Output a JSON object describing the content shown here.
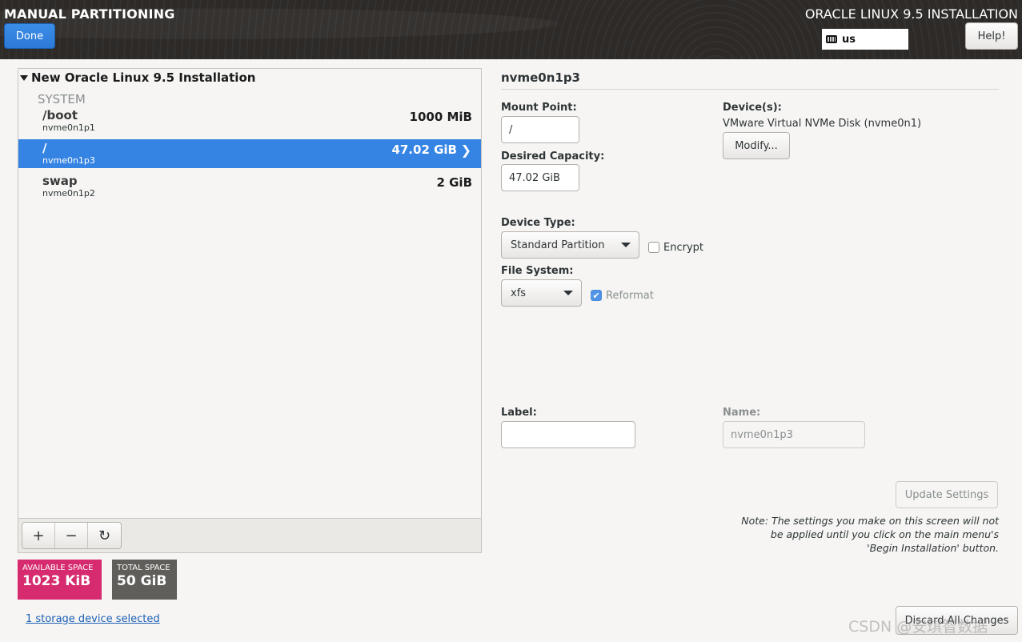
{
  "header": {
    "title": "MANUAL PARTITIONING",
    "product": "ORACLE LINUX 9.5 INSTALLATION",
    "done_label": "Done",
    "keyboard_layout": "us",
    "help_label": "Help!"
  },
  "tree": {
    "installation_title": "New Oracle Linux 9.5 Installation",
    "group_label": "SYSTEM",
    "partitions": [
      {
        "mount": "/boot",
        "device": "nvme0n1p1",
        "size": "1000 MiB",
        "selected": false
      },
      {
        "mount": "/",
        "device": "nvme0n1p3",
        "size": "47.02 GiB",
        "selected": true
      },
      {
        "mount": "swap",
        "device": "nvme0n1p2",
        "size": "2 GiB",
        "selected": false
      }
    ]
  },
  "toolbar": {
    "add_label": "+",
    "remove_label": "−",
    "refresh_label": "↻"
  },
  "space": {
    "available_label": "AVAILABLE SPACE",
    "available_value": "1023 KiB",
    "total_label": "TOTAL SPACE",
    "total_value": "50 GiB",
    "available_color": "#d62b6e",
    "total_color": "#5f5e5b"
  },
  "storage_link": "1 storage device selected",
  "detail": {
    "partition_name": "nvme0n1p3",
    "mount_point_label": "Mount Point:",
    "mount_point_value": "/",
    "capacity_label": "Desired Capacity:",
    "capacity_value": "47.02 GiB",
    "devices_label": "Device(s):",
    "devices_value": "VMware Virtual NVMe Disk (nvme0n1)",
    "modify_label": "Modify...",
    "device_type_label": "Device Type:",
    "device_type_value": "Standard Partition",
    "encrypt_label": "Encrypt",
    "encrypt_checked": false,
    "filesystem_label": "File System:",
    "filesystem_value": "xfs",
    "reformat_label": "Reformat",
    "reformat_checked": true,
    "label_label": "Label:",
    "label_value": "",
    "name_label": "Name:",
    "name_value": "nvme0n1p3",
    "update_label": "Update Settings",
    "note": "Note:  The settings you make on this screen will not be applied until you click on the main menu's 'Begin Installation' button.",
    "discard_label": "Discard All Changes"
  },
  "watermark": "CSDN @安琪智数据",
  "accent_color": "#3584e4"
}
